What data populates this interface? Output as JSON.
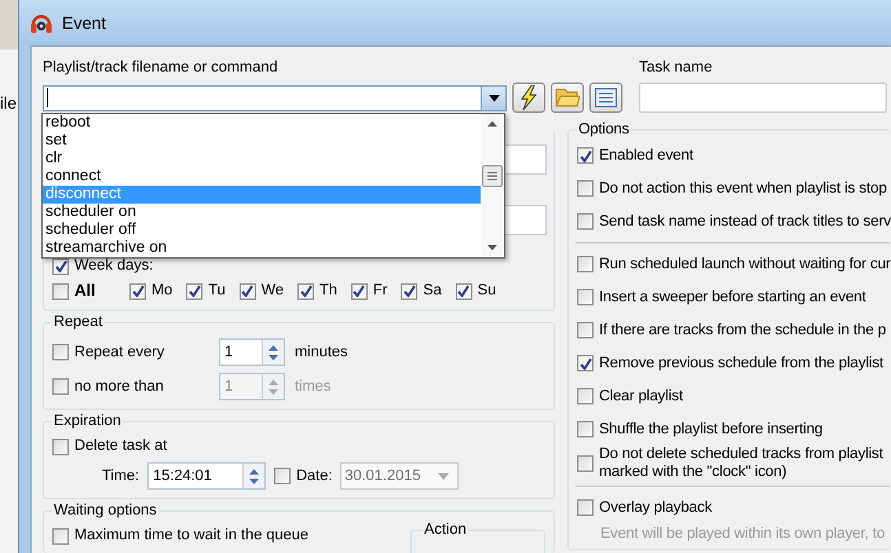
{
  "background_app": {
    "menu_text": "ile"
  },
  "window": {
    "title": "Event"
  },
  "command": {
    "label": "Playlist/track filename or command",
    "dropdown": {
      "items": [
        {
          "label": "reboot",
          "selected": false
        },
        {
          "label": "set",
          "selected": false
        },
        {
          "label": "clr",
          "selected": false
        },
        {
          "label": "connect",
          "selected": false
        },
        {
          "label": "disconnect",
          "selected": true
        },
        {
          "label": "scheduler on",
          "selected": false
        },
        {
          "label": "scheduler off",
          "selected": false
        },
        {
          "label": "streamarchive on",
          "selected": false
        }
      ]
    }
  },
  "task_name": {
    "label": "Task name"
  },
  "week_days": {
    "label": "Week days:",
    "checked": true,
    "all": {
      "label": "All",
      "checked": false
    },
    "days": [
      {
        "label": "Mo",
        "checked": true
      },
      {
        "label": "Tu",
        "checked": true
      },
      {
        "label": "We",
        "checked": true
      },
      {
        "label": "Th",
        "checked": true
      },
      {
        "label": "Fr",
        "checked": true
      },
      {
        "label": "Sa",
        "checked": true
      },
      {
        "label": "Su",
        "checked": true
      }
    ]
  },
  "repeat": {
    "title": "Repeat",
    "rows": [
      {
        "label": "Repeat every",
        "checked": false,
        "value": "1",
        "unit": "minutes",
        "disabled": false
      },
      {
        "label": "no more than",
        "checked": false,
        "value": "1",
        "unit": "times",
        "disabled": true
      }
    ]
  },
  "expiration": {
    "title": "Expiration",
    "delete": {
      "label": "Delete task at",
      "checked": false
    },
    "time": {
      "label": "Time:",
      "value": "15:24:01"
    },
    "date": {
      "label": "Date:",
      "checked": false,
      "value": "30.01.2015",
      "disabled": true
    }
  },
  "waiting": {
    "title": "Waiting options",
    "max_wait": {
      "label": "Maximum time to wait in the queue",
      "checked": false
    },
    "action_title": "Action"
  },
  "options": {
    "title": "Options",
    "items": [
      {
        "kind": "check",
        "label": "Enabled event",
        "checked": true
      },
      {
        "kind": "check",
        "label": "Do not action this event when playlist is stop",
        "checked": false
      },
      {
        "kind": "check",
        "label": "Send task name instead of track titles to serv",
        "checked": false
      },
      {
        "kind": "divider"
      },
      {
        "kind": "check",
        "label": "Run scheduled launch without waiting for cur",
        "checked": false
      },
      {
        "kind": "check",
        "label": "Insert a sweeper before starting an event",
        "checked": false
      },
      {
        "kind": "check",
        "label": "If there are tracks from the schedule in the p",
        "checked": false
      },
      {
        "kind": "check",
        "label": "Remove previous schedule from the playlist",
        "checked": true
      },
      {
        "kind": "check",
        "label": "Clear playlist",
        "checked": false
      },
      {
        "kind": "check",
        "label": "Shuffle the playlist before inserting",
        "checked": false
      },
      {
        "kind": "check",
        "label": "Do not delete scheduled tracks from playlist\nmarked with the \"clock\" icon)",
        "checked": false
      },
      {
        "kind": "divider"
      },
      {
        "kind": "check",
        "label": "Overlay playback",
        "checked": false
      },
      {
        "kind": "note",
        "label": "Event will be played within its own player, to"
      }
    ]
  }
}
